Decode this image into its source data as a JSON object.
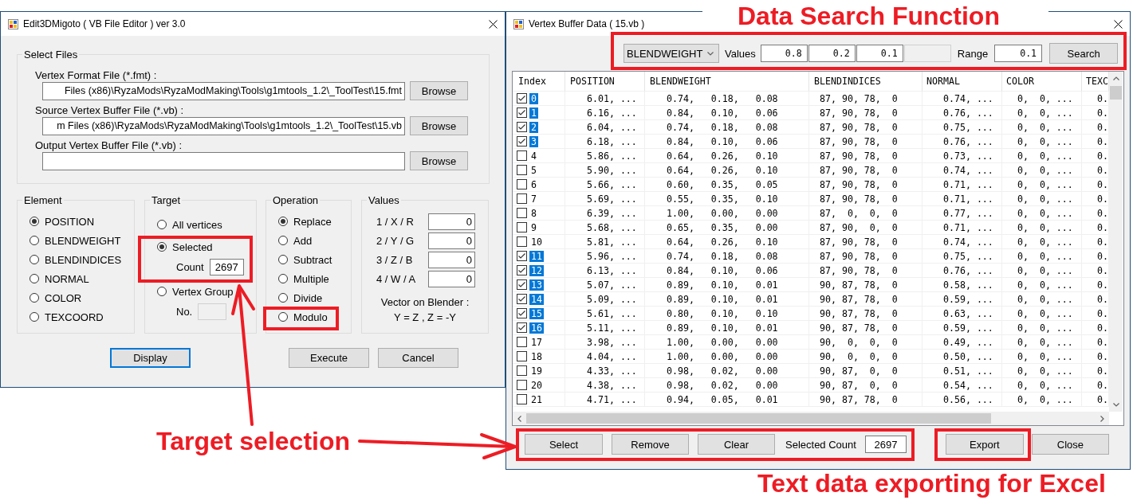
{
  "editor_window": {
    "title": "Edit3DMigoto ( VB File Editor ) ver 3.0",
    "select_files": {
      "title": "Select Files",
      "files": [
        {
          "label": "Vertex Format File (*.fmt) :",
          "value": "Files (x86)\\RyzaMods\\RyzaModMaking\\Tools\\g1mtools_1.2\\_ToolTest\\15.fmt",
          "button": "Browse"
        },
        {
          "label": "Source Vertex Buffer File (*.vb) :",
          "value": "m Files (x86)\\RyzaMods\\RyzaModMaking\\Tools\\g1mtools_1.2\\_ToolTest\\15.vb",
          "button": "Browse"
        },
        {
          "label": "Output Vertex Buffer File (*.vb) :",
          "button": "Browse"
        }
      ]
    },
    "element": {
      "title": "Element",
      "options": [
        {
          "label": "POSITION",
          "selected": true
        },
        {
          "label": "BLENDWEIGHT",
          "selected": false
        },
        {
          "label": "BLENDINDICES",
          "selected": false
        },
        {
          "label": "NORMAL",
          "selected": false
        },
        {
          "label": "COLOR",
          "selected": false
        },
        {
          "label": "TEXCOORD",
          "selected": false
        }
      ]
    },
    "target": {
      "title": "Target",
      "options": [
        {
          "label": "All vertices",
          "selected": false
        },
        {
          "label": "Selected",
          "selected": true,
          "field": {
            "label": "Count",
            "value": "2697",
            "disabled": false
          }
        },
        {
          "label": "Vertex Group",
          "selected": false,
          "field": {
            "label": "No.",
            "disabled": true
          }
        }
      ]
    },
    "operation": {
      "title": "Operation",
      "options": [
        {
          "label": "Replace",
          "selected": true
        },
        {
          "label": "Add",
          "selected": false
        },
        {
          "label": "Subtract",
          "selected": false
        },
        {
          "label": "Multiple",
          "selected": false
        },
        {
          "label": "Divide",
          "selected": false
        },
        {
          "label": "Modulo",
          "selected": false
        }
      ]
    },
    "values": {
      "title": "Values",
      "rows": [
        {
          "label": "1 / X / R",
          "value": "0"
        },
        {
          "label": "2 / Y / G",
          "value": "0"
        },
        {
          "label": "3 / Z / B",
          "value": "0"
        },
        {
          "label": "4 / W / A",
          "value": "0"
        }
      ],
      "note": [
        "Vector on Blender :",
        "Y = Z , Z = -Y"
      ]
    },
    "buttons": [
      {
        "label": "Display",
        "default": true
      },
      {
        "label": "Execute",
        "default": false
      },
      {
        "label": "Cancel",
        "default": false
      }
    ]
  },
  "data_window": {
    "title": "Vertex Buffer Data ( 15.vb )",
    "search": {
      "element": "BLENDWEIGHT",
      "values_label": "Values",
      "values": [
        {
          "value": "0.8",
          "disabled": false
        },
        {
          "value": "0.2",
          "disabled": false
        },
        {
          "value": "0.1",
          "disabled": false
        },
        {
          "disabled": true
        }
      ],
      "range_label": "Range",
      "range": "0.1",
      "button": "Search"
    },
    "table": {
      "columns": [
        "Index",
        "POSITION",
        "BLENDWEIGHT",
        "BLENDINDICES",
        "NORMAL",
        "COLOR",
        "TEXC"
      ],
      "rows": [
        {
          "checked": true,
          "selected": true,
          "cells": [
            "0",
            "6.01, ...",
            "0.74,   0.18,   0.08",
            "87, 90, 78,  0",
            "0.74, ...",
            "0,  0, ...",
            "0."
          ]
        },
        {
          "checked": true,
          "selected": true,
          "cells": [
            "1",
            "6.16, ...",
            "0.84,   0.10,   0.06",
            "87, 90, 78,  0",
            "0.76, ...",
            "0,  0, ...",
            "0."
          ]
        },
        {
          "checked": true,
          "selected": true,
          "cells": [
            "2",
            "6.04, ...",
            "0.74,   0.18,   0.08",
            "87, 90, 78,  0",
            "0.75, ...",
            "0,  0, ...",
            "0."
          ]
        },
        {
          "checked": true,
          "selected": true,
          "cells": [
            "3",
            "6.18, ...",
            "0.84,   0.10,   0.06",
            "87, 90, 78,  0",
            "0.76, ...",
            "0,  0, ...",
            "0."
          ]
        },
        {
          "checked": false,
          "selected": false,
          "cells": [
            "4",
            "5.86, ...",
            "0.64,   0.26,   0.10",
            "87, 90, 78,  0",
            "0.73, ...",
            "0,  0, ...",
            "0."
          ]
        },
        {
          "checked": false,
          "selected": false,
          "cells": [
            "5",
            "5.90, ...",
            "0.64,   0.26,   0.10",
            "87, 90, 78,  0",
            "0.74, ...",
            "0,  0, ...",
            "0."
          ]
        },
        {
          "checked": false,
          "selected": false,
          "cells": [
            "6",
            "5.66, ...",
            "0.60,   0.35,   0.05",
            "87, 90, 78,  0",
            "0.71, ...",
            "0,  0, ...",
            "0."
          ]
        },
        {
          "checked": false,
          "selected": false,
          "cells": [
            "7",
            "5.69, ...",
            "0.55,   0.35,   0.10",
            "87, 90, 78,  0",
            "0.71, ...",
            "0,  0, ...",
            "0."
          ]
        },
        {
          "checked": false,
          "selected": false,
          "cells": [
            "8",
            "6.39, ...",
            "1.00,   0.00,   0.00",
            "87,  0,  0,  0",
            "0.77, ...",
            "0,  0, ...",
            "0."
          ]
        },
        {
          "checked": false,
          "selected": false,
          "cells": [
            "9",
            "5.68, ...",
            "0.65,   0.35,   0.00",
            "87, 90,  0,  0",
            "0.71, ...",
            "0,  0, ...",
            "0."
          ]
        },
        {
          "checked": false,
          "selected": false,
          "cells": [
            "10",
            "5.81, ...",
            "0.64,   0.26,   0.10",
            "87, 90, 78,  0",
            "0.74, ...",
            "0,  0, ...",
            "0."
          ]
        },
        {
          "checked": true,
          "selected": true,
          "cells": [
            "11",
            "5.96, ...",
            "0.74,   0.18,   0.08",
            "87, 90, 78,  0",
            "0.75, ...",
            "0,  0, ...",
            "0."
          ]
        },
        {
          "checked": true,
          "selected": true,
          "cells": [
            "12",
            "6.13, ...",
            "0.84,   0.10,   0.06",
            "87, 90, 78,  0",
            "0.76, ...",
            "0,  0, ...",
            "0."
          ]
        },
        {
          "checked": true,
          "selected": true,
          "cells": [
            "13",
            "5.07, ...",
            "0.89,   0.10,   0.01",
            "90, 87, 78,  0",
            "0.58, ...",
            "0,  0, ...",
            "0."
          ]
        },
        {
          "checked": true,
          "selected": true,
          "cells": [
            "14",
            "5.09, ...",
            "0.89,   0.10,   0.01",
            "90, 87, 78,  0",
            "0.59, ...",
            "0,  0, ...",
            "0."
          ]
        },
        {
          "checked": true,
          "selected": true,
          "cells": [
            "15",
            "5.61, ...",
            "0.80,   0.10,   0.10",
            "90, 87, 78,  0",
            "0.63, ...",
            "0,  0, ...",
            "0."
          ]
        },
        {
          "checked": true,
          "selected": true,
          "cells": [
            "16",
            "5.11, ...",
            "0.89,   0.10,   0.01",
            "90, 87, 78,  0",
            "0.59, ...",
            "0,  0, ...",
            "0."
          ]
        },
        {
          "checked": false,
          "selected": false,
          "cells": [
            "17",
            "3.98, ...",
            "1.00,   0.00,   0.00",
            "90,  0,  0,  0",
            "0.49, ...",
            "0,  0, ...",
            "0."
          ]
        },
        {
          "checked": false,
          "selected": false,
          "cells": [
            "18",
            "4.04, ...",
            "1.00,   0.00,   0.00",
            "90,  0,  0,  0",
            "0.50, ...",
            "0,  0, ...",
            "0."
          ]
        },
        {
          "checked": false,
          "selected": false,
          "cells": [
            "19",
            "4.33, ...",
            "0.98,   0.02,   0.00",
            "90, 87,  0,  0",
            "0.51, ...",
            "0,  0, ...",
            "0."
          ]
        },
        {
          "checked": false,
          "selected": false,
          "cells": [
            "20",
            "4.38, ...",
            "0.98,   0.02,   0.00",
            "90, 87,  0,  0",
            "0.54, ...",
            "0,  0, ...",
            "0."
          ]
        },
        {
          "checked": false,
          "selected": false,
          "cells": [
            "21",
            "4.71, ...",
            "0.94,   0.05,   0.01",
            "90, 87, 78,  0",
            "0.56, ...",
            "0,  0, ...",
            "0."
          ]
        }
      ]
    },
    "selection": {
      "buttons": [
        "Select",
        "Remove",
        "Clear"
      ],
      "count_label": "Selected Count",
      "count": "2697"
    },
    "buttons": [
      "Export",
      "Close"
    ]
  },
  "annotations": {
    "search_title": "Data Search Function",
    "target_title": "Target selection",
    "export_title": "Text data exporting for Excel"
  }
}
